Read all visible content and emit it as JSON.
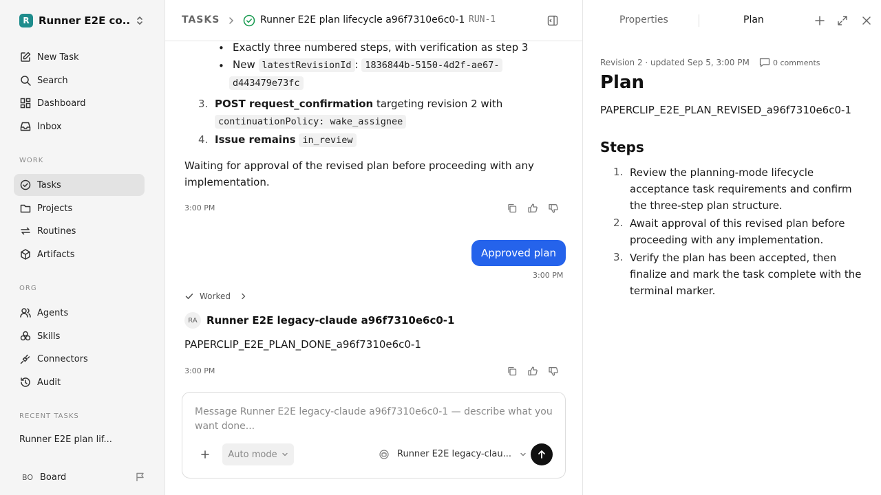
{
  "workspace": {
    "name": "Runner E2E co...",
    "logo_letter": "R"
  },
  "sidebar": {
    "nav": [
      {
        "label": "New Task",
        "icon": "new-task-icon"
      },
      {
        "label": "Search",
        "icon": "search-icon"
      },
      {
        "label": "Dashboard",
        "icon": "dashboard-icon"
      },
      {
        "label": "Inbox",
        "icon": "inbox-icon"
      }
    ],
    "work_heading": "WORK",
    "work": [
      {
        "label": "Tasks",
        "icon": "check-circle-icon",
        "active": true
      },
      {
        "label": "Projects",
        "icon": "folder-icon"
      },
      {
        "label": "Routines",
        "icon": "repeat-icon"
      },
      {
        "label": "Artifacts",
        "icon": "box-icon"
      }
    ],
    "org_heading": "ORG",
    "org": [
      {
        "label": "Agents",
        "icon": "users-icon"
      },
      {
        "label": "Skills",
        "icon": "skills-icon"
      },
      {
        "label": "Connectors",
        "icon": "plug-icon"
      },
      {
        "label": "Audit",
        "icon": "history-icon"
      }
    ],
    "recent_heading": "RECENT TASKS",
    "recent": [
      "Runner E2E plan lif..."
    ],
    "footer": {
      "avatar": "BO",
      "label": "Board"
    }
  },
  "breadcrumb": {
    "root": "TASKS",
    "title": "Runner E2E plan lifecycle a96f7310e6c0-1",
    "run_id": "RUN-1"
  },
  "feed": {
    "bullet1": "Exactly three numbered steps, with verification as step 3",
    "bullet2_prefix": "New",
    "bullet2_code": "latestRevisionId",
    "bullet2_colon": ":",
    "bullet2_value_a": "1836844b-5150-4d2f-ae67-",
    "bullet2_value_b": "d443479e73fc",
    "item3_num": "3.",
    "item3_bold": "POST request_confirmation",
    "item3_rest": "targeting revision 2 with",
    "item3_code": "continuationPolicy: wake_assignee",
    "item4_num": "4.",
    "item4_bold": "Issue remains",
    "item4_code": "in_review",
    "para": "Waiting for approval of the revised plan before proceeding with any implementation.",
    "time1": "3:00 PM",
    "user_message": "Approved plan",
    "time_user": "3:00 PM",
    "worked_label": "Worked",
    "agent_initials": "RA",
    "agent_name": "Runner E2E legacy-claude a96f7310e6c0-1",
    "agent_message": "PAPERCLIP_E2E_PLAN_DONE_a96f7310e6c0-1",
    "time2": "3:00 PM"
  },
  "composer": {
    "placeholder": "Message Runner E2E legacy-claude a96f7310e6c0-1 — describe what you want done...",
    "mode": "Auto mode",
    "agent": "Runner E2E legacy-clau..."
  },
  "panel": {
    "tabs": [
      "Properties",
      "Plan"
    ],
    "selected_tab": "Plan",
    "revision": "Revision 2 · updated Sep 5, 3:00 PM",
    "comments": "0 comments",
    "heading": "Plan",
    "plan_id": "PAPERCLIP_E2E_PLAN_REVISED_a96f7310e6c0-1",
    "steps_heading": "Steps",
    "steps": [
      {
        "num": "1.",
        "text": "Review the planning-mode lifecycle acceptance task requirements and confirm the three-step plan structure."
      },
      {
        "num": "2.",
        "text": "Await approval of this revised plan before proceeding with any implementation."
      },
      {
        "num": "3.",
        "text": "Verify the plan has been accepted, then finalize and mark the task complete with the terminal marker."
      }
    ]
  },
  "colors": {
    "accent": "#2563eb",
    "success": "#1f9d55",
    "sidebar_bg": "#f5f5f5",
    "logo": "#1e8c8c"
  }
}
